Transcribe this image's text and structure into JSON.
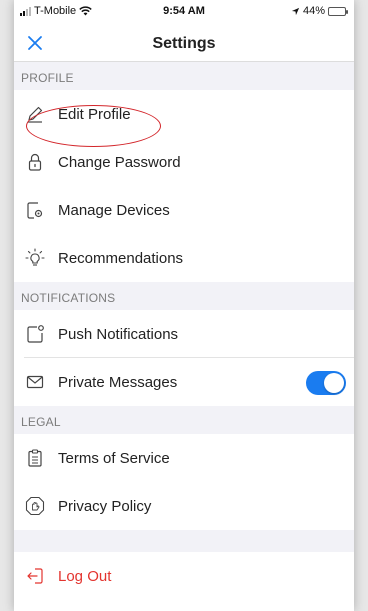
{
  "status_bar": {
    "carrier": "T-Mobile",
    "time": "9:54 AM",
    "battery_percent": "44%"
  },
  "nav": {
    "title": "Settings"
  },
  "sections": {
    "profile": {
      "header": "PROFILE",
      "items": [
        {
          "label": "Edit Profile",
          "icon": "pencil-icon"
        },
        {
          "label": "Change Password",
          "icon": "lock-icon"
        },
        {
          "label": "Manage Devices",
          "icon": "devices-icon"
        },
        {
          "label": "Recommendations",
          "icon": "lightbulb-icon"
        }
      ]
    },
    "notifications": {
      "header": "NOTIFICATIONS",
      "items": [
        {
          "label": "Push Notifications",
          "icon": "push-notification-icon"
        },
        {
          "label": "Private Messages",
          "icon": "envelope-icon",
          "toggle": true
        }
      ]
    },
    "legal": {
      "header": "LEGAL",
      "items": [
        {
          "label": "Terms of Service",
          "icon": "clipboard-icon"
        },
        {
          "label": "Privacy Policy",
          "icon": "privacy-shield-icon"
        }
      ]
    }
  },
  "logout": {
    "label": "Log Out",
    "icon": "logout-icon"
  },
  "colors": {
    "accent": "#1a7cf0",
    "danger": "#e3342f",
    "annotation": "#d3262b"
  }
}
